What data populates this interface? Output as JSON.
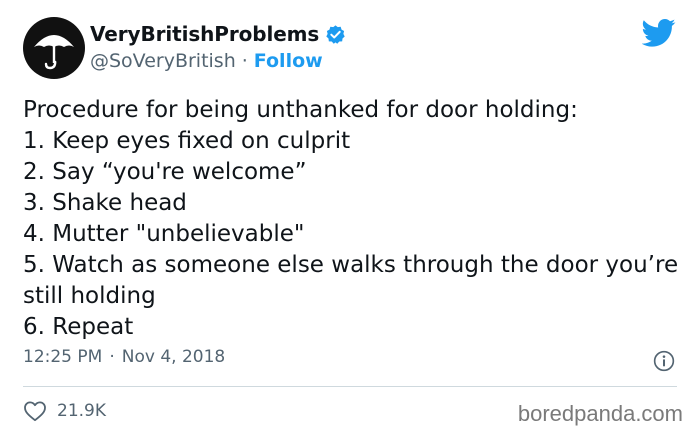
{
  "author": {
    "display_name": "VeryBritishProblems",
    "handle": "@SoVeryBritish",
    "separator": "·",
    "follow_label": "Follow",
    "verified_icon": "verified-badge-icon",
    "avatar_icon": "umbrella-icon"
  },
  "platform_icon": "twitter-bird-icon",
  "tweet": {
    "lines": [
      "Procedure for being unthanked for door holding:",
      "1. Keep eyes fixed on culprit",
      "2. Say “you're welcome”",
      "3. Shake head",
      "4. Mutter \"unbelievable\"",
      "5. Watch as someone else walks through the door you’re still holding",
      "6. Repeat"
    ]
  },
  "meta": {
    "time": "12:25 PM",
    "separator": "·",
    "date": "Nov 4, 2018",
    "info_icon": "info-icon"
  },
  "engagement": {
    "like_icon": "heart-icon",
    "likes": "21.9K"
  },
  "watermark": "boredpanda.com",
  "colors": {
    "accent": "#1d9bf0",
    "text": "#0f1419",
    "secondary": "#536471",
    "divider": "#cfd9de"
  }
}
